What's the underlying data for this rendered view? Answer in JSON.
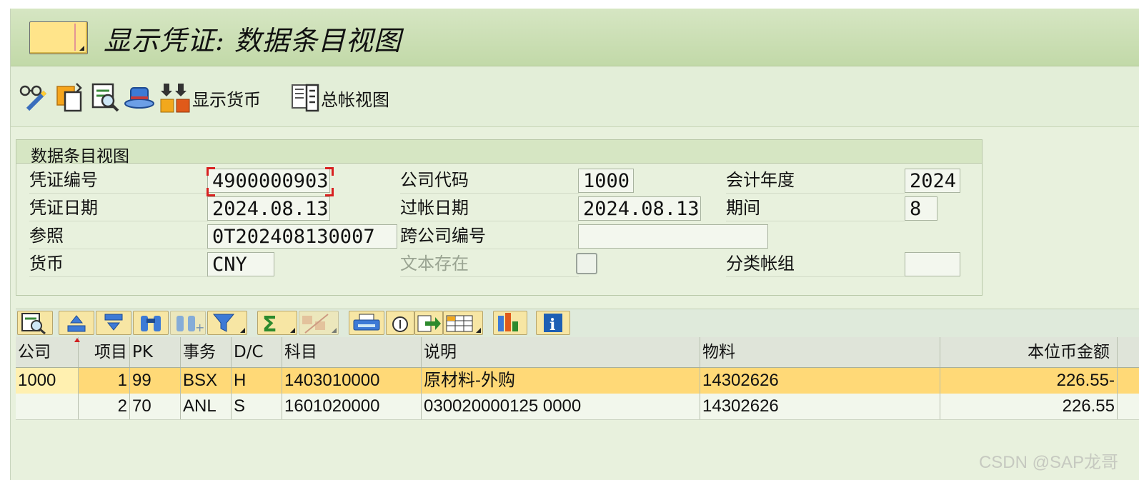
{
  "window": {
    "title": "显示凭证: 数据条目视图"
  },
  "toolbar": {
    "items": [
      {
        "icon": "glasses-pencil-icon"
      },
      {
        "icon": "copy-document-icon"
      },
      {
        "icon": "document-search-icon"
      },
      {
        "icon": "hat-icon"
      },
      {
        "icon": "display-currency-icon",
        "label": "显示货币"
      },
      {
        "icon": "general-ledger-icon",
        "label": "总帐视图"
      }
    ]
  },
  "group": {
    "title": "数据条目视图",
    "fields": {
      "doc_number": {
        "label": "凭证编号",
        "value": "4900000903"
      },
      "company_code": {
        "label": "公司代码",
        "value": "1000"
      },
      "fiscal_year": {
        "label": "会计年度",
        "value": "2024"
      },
      "doc_date": {
        "label": "凭证日期",
        "value": "2024.08.13"
      },
      "posting_date": {
        "label": "过帐日期",
        "value": "2024.08.13"
      },
      "period": {
        "label": "期间",
        "value": "8"
      },
      "reference": {
        "label": "参照",
        "value": "0T202408130007"
      },
      "cross_company": {
        "label": "跨公司编号",
        "value": ""
      },
      "currency": {
        "label": "货币",
        "value": "CNY"
      },
      "text_exists": {
        "label": "文本存在",
        "checked": false
      },
      "ledger_group": {
        "label": "分类帐组",
        "value": ""
      }
    }
  },
  "alv_toolbar": {
    "buttons": [
      "details-icon",
      "sort-ascending-icon",
      "sort-descending-icon",
      "find-icon",
      "find-next-icon",
      "filter-icon",
      "sum-icon",
      "subtotal-icon",
      "print-icon",
      "views-icon",
      "export-icon",
      "layout-icon",
      "graphic-icon",
      "info-icon"
    ]
  },
  "table": {
    "columns": [
      "公司",
      "项目",
      "PK",
      "事务",
      "D/C",
      "科目",
      "说明",
      "物料",
      "本位币金额"
    ],
    "rows": [
      [
        "1000",
        "1",
        "99",
        "BSX",
        "H",
        "1403010000",
        "原材料-外购",
        "14302626",
        "226.55-"
      ],
      [
        "",
        "2",
        "70",
        "ANL",
        "S",
        "1601020000",
        "030020000125 0000",
        "14302626",
        "226.55"
      ]
    ]
  },
  "watermark": "CSDN @SAP龙哥"
}
